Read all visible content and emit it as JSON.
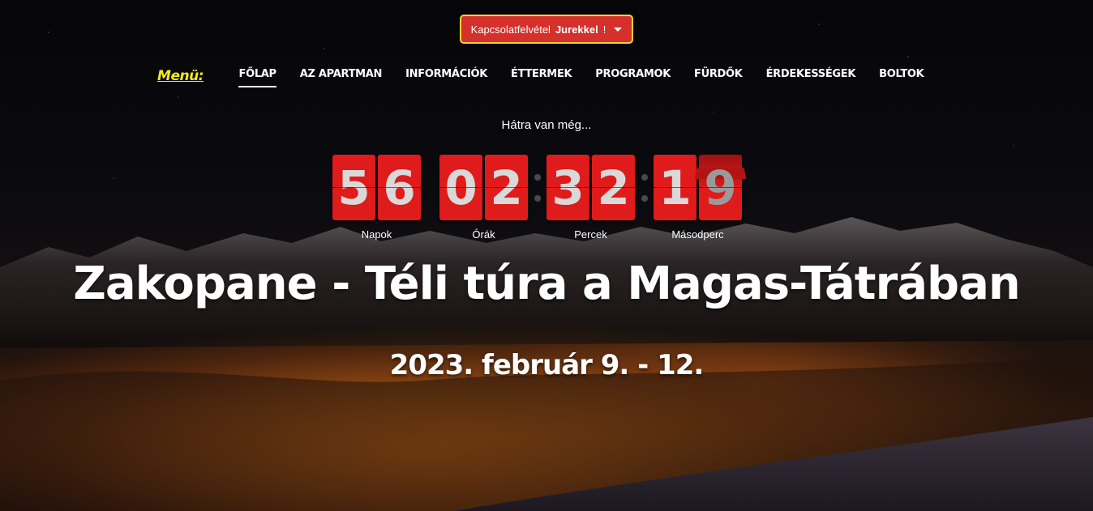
{
  "contact": {
    "label": "Kapcsolatfelvétel",
    "name": "Jurekkel",
    "suffix": "!"
  },
  "nav": {
    "menu_label": "Menü:",
    "items": [
      "FŐLAP",
      "AZ APARTMAN",
      "INFORMÁCIÓK",
      "ÉTTERMEK",
      "PROGRAMOK",
      "FÜRDŐK",
      "ÉRDEKESSÉGEK",
      "BOLTOK"
    ]
  },
  "countdown": {
    "lead": "Hátra van még...",
    "groups": [
      {
        "digits": [
          "5",
          "6"
        ],
        "unit": "Napok"
      },
      {
        "digits": [
          "0",
          "2"
        ],
        "unit": "Órák"
      },
      {
        "digits": [
          "3",
          "2"
        ],
        "unit": "Percek"
      },
      {
        "digits": [
          "1",
          "9"
        ],
        "unit": "Másodperc"
      }
    ]
  },
  "hero": {
    "title": "Zakopane - Téli túra a Magas-Tátrában",
    "date": "2023. február 9. - 12."
  },
  "colors": {
    "accent_red": "#e01b1b",
    "button_border": "#f2d23c",
    "menu_yellow": "#f4ea1e"
  }
}
